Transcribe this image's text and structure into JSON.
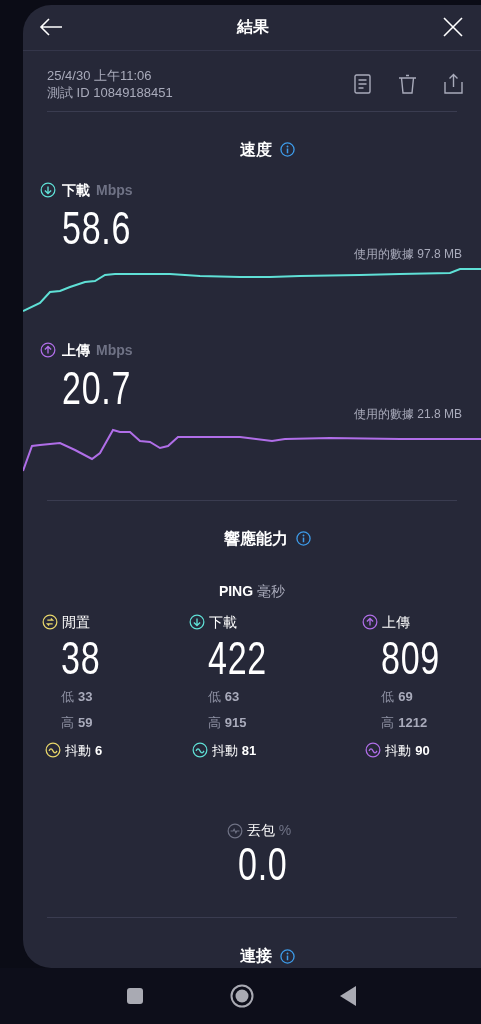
{
  "header": {
    "title": "結果"
  },
  "meta": {
    "date": "25/4/30 上午11:06",
    "test_id": "測試 ID 10849188451"
  },
  "speed": {
    "title": "速度",
    "metrics": [
      {
        "kind": "download",
        "label": "下載",
        "unit": "Mbps",
        "value": "58.6",
        "data_used": "使用的數據 97.8 MB"
      },
      {
        "kind": "upload",
        "label": "上傳",
        "unit": "Mbps",
        "value": "20.7",
        "data_used": "使用的數據 21.8 MB"
      }
    ]
  },
  "responsiveness": {
    "title": "響應能力",
    "ping_label": "PING",
    "ping_unit": "毫秒",
    "columns": [
      {
        "kind": "idle",
        "label": "閒置",
        "value": "38",
        "low_label": "低",
        "low": "33",
        "high_label": "高",
        "high": "59",
        "jitter_label": "抖動",
        "jitter": "6"
      },
      {
        "kind": "download",
        "label": "下載",
        "value": "422",
        "low_label": "低",
        "low": "63",
        "high_label": "高",
        "high": "915",
        "jitter_label": "抖動",
        "jitter": "81"
      },
      {
        "kind": "upload",
        "label": "上傳",
        "value": "809",
        "low_label": "低",
        "low": "69",
        "high_label": "高",
        "high": "1212",
        "jitter_label": "抖動",
        "jitter": "90"
      }
    ],
    "packet_loss": {
      "label": "丟包",
      "unit": "%",
      "value": "0.0"
    }
  },
  "connection": {
    "title": "連接"
  }
}
